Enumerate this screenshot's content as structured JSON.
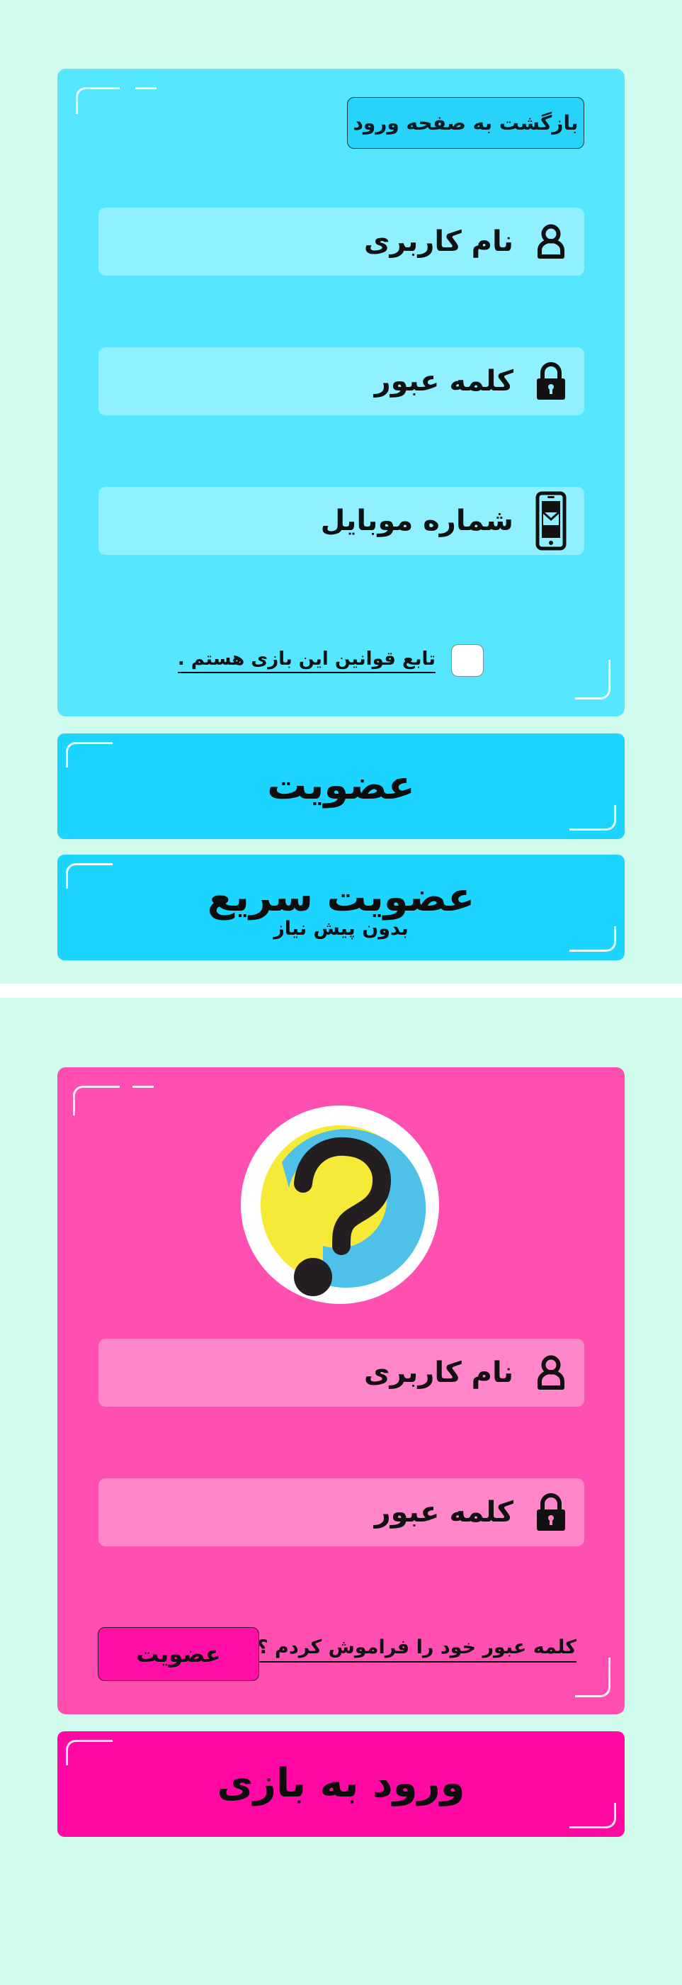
{
  "register": {
    "back_button": "بازگشت به صفحه ورود",
    "username_label": "نام کاربری",
    "password_label": "کلمه عبور",
    "mobile_label": "شماره موبایل",
    "terms_text": "تابع قوانین این بازی هستم .",
    "terms_checked": false,
    "signup_button": "عضویت",
    "quick_signup_button": "عضویت سریع",
    "quick_signup_subtitle": "بدون پیش نیاز"
  },
  "login": {
    "logo_icon": "question-mark-logo",
    "username_label": "نام کاربری",
    "password_label": "کلمه عبور",
    "forgot_password_link": "کلمه عبور خود را فراموش کردم ؟",
    "signup_button": "عضویت",
    "enter_game_button": "ورود به بازی"
  },
  "icons": {
    "user": "user-icon",
    "lock": "lock-icon",
    "mobile": "mobile-phone-icon"
  },
  "colors": {
    "background": "#d1fbed",
    "register_panel": "#57e6ff",
    "register_field": "#90f0ff",
    "register_button": "#1bd4ff",
    "login_panel": "#ff4fb0",
    "login_field": "#ff86c8",
    "login_button": "#ff08a4",
    "logo_blue": "#4ec1e8",
    "logo_yellow": "#f7e937",
    "logo_dark": "#231f20"
  }
}
